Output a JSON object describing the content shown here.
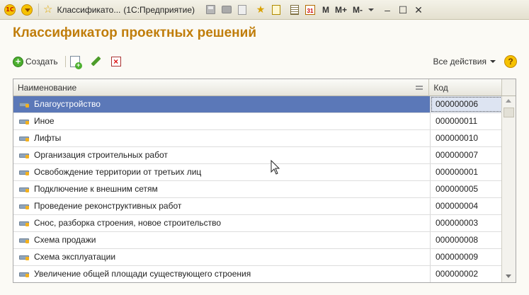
{
  "window": {
    "title": "Классификато...",
    "title_tail": "(1С:Предприятие)",
    "logo_text": "1С",
    "calendar_text": "31",
    "memory_buttons": [
      "M",
      "M+",
      "M-"
    ],
    "controls": {
      "minimize": "–",
      "maximize": "☐",
      "close": "✕"
    }
  },
  "page": {
    "title": "Классификатор проектных решений"
  },
  "toolbar": {
    "create_label": "Создать",
    "all_actions_label": "Все действия",
    "help_symbol": "?"
  },
  "table": {
    "columns": {
      "name": "Наименование",
      "code": "Код"
    },
    "selected_index": 0,
    "rows": [
      {
        "name": "Благоустройство",
        "code": "000000006"
      },
      {
        "name": "Иное",
        "code": "000000011"
      },
      {
        "name": "Лифты",
        "code": "000000010"
      },
      {
        "name": "Организация строительных работ",
        "code": "000000007"
      },
      {
        "name": "Освобождение территории от третьих лиц",
        "code": "000000001"
      },
      {
        "name": "Подключение к внешним сетям",
        "code": "000000005"
      },
      {
        "name": "Проведение реконструктивных работ",
        "code": "000000004"
      },
      {
        "name": "Снос, разборка строения, новое строительство",
        "code": "000000003"
      },
      {
        "name": "Схема продажи",
        "code": "000000008"
      },
      {
        "name": "Схема эксплуатации",
        "code": "000000009"
      },
      {
        "name": "Увеличение общей площади существующего строения",
        "code": "000000002"
      }
    ]
  },
  "colors": {
    "title": "#c07d0a",
    "selection": "#5b78b8",
    "accent_green": "#4caf2f"
  }
}
